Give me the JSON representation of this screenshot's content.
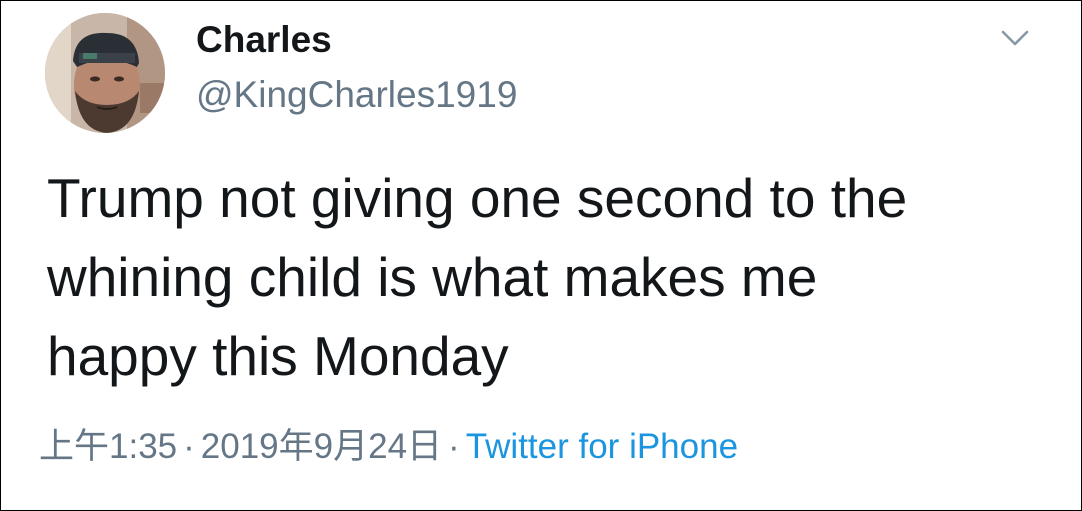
{
  "tweet": {
    "author": {
      "display_name": "Charles",
      "handle": "@KingCharles1919"
    },
    "text_lines": [
      "Trump not giving one second to the",
      "whining child is what makes me",
      "happy this Monday"
    ],
    "time": "上午1:35",
    "separator": "·",
    "date": "2019年9月24日",
    "source": "Twitter for iPhone"
  },
  "icons": {
    "menu": "chevron-down-icon"
  },
  "colors": {
    "text": "#14171a",
    "secondary": "#657786",
    "link": "#1b95e0"
  }
}
